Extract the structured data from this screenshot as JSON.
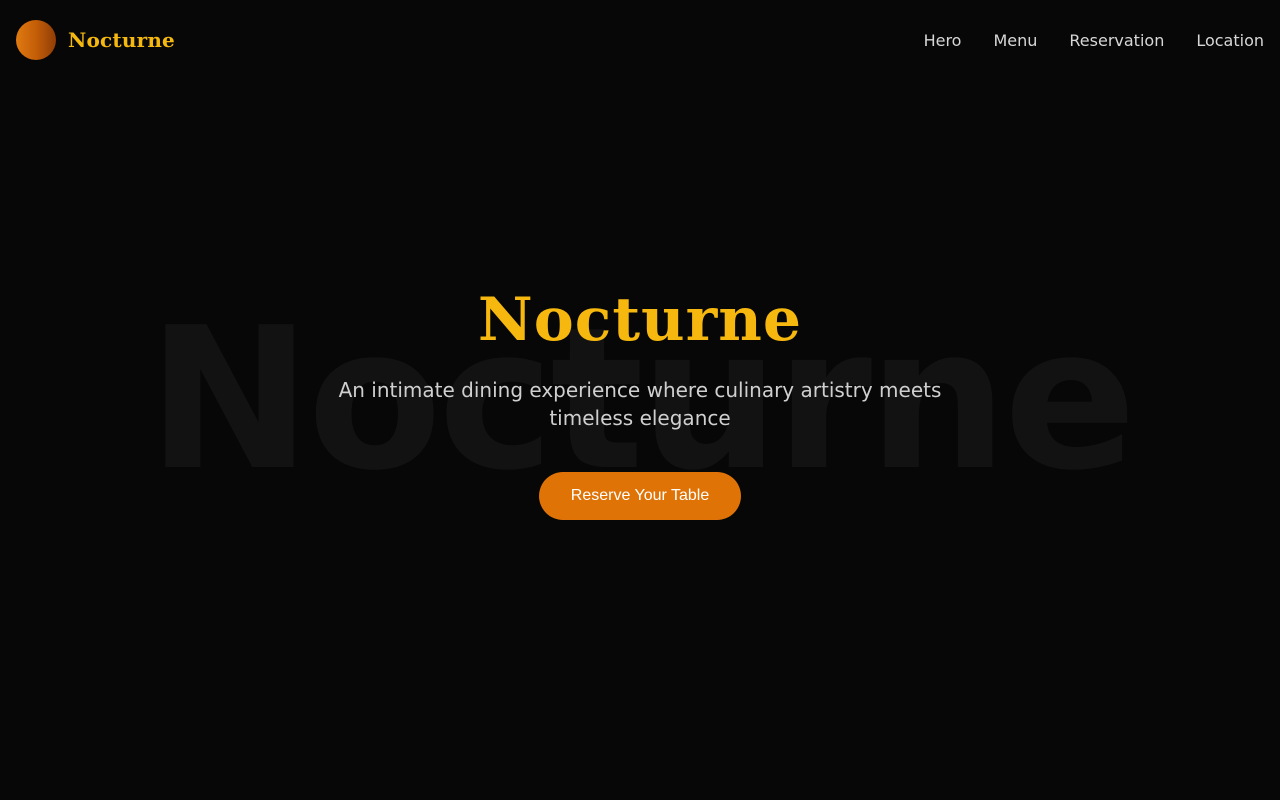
{
  "header": {
    "brand_name": "Nocturne",
    "logo_icon": "moon-logo-icon",
    "nav": [
      {
        "label": "Hero"
      },
      {
        "label": "Menu"
      },
      {
        "label": "Reservation"
      },
      {
        "label": "Location"
      }
    ]
  },
  "hero": {
    "watermark": "Nocturne",
    "title": "Nocturne",
    "subtitle": "An intimate dining experience where culinary artistry meets timeless elegance",
    "cta_label": "Reserve Your Table"
  },
  "colors": {
    "background": "#070707",
    "accent_gold": "#f6b80e",
    "cta_orange": "#e07305",
    "nav_text": "#d7d7d7"
  }
}
